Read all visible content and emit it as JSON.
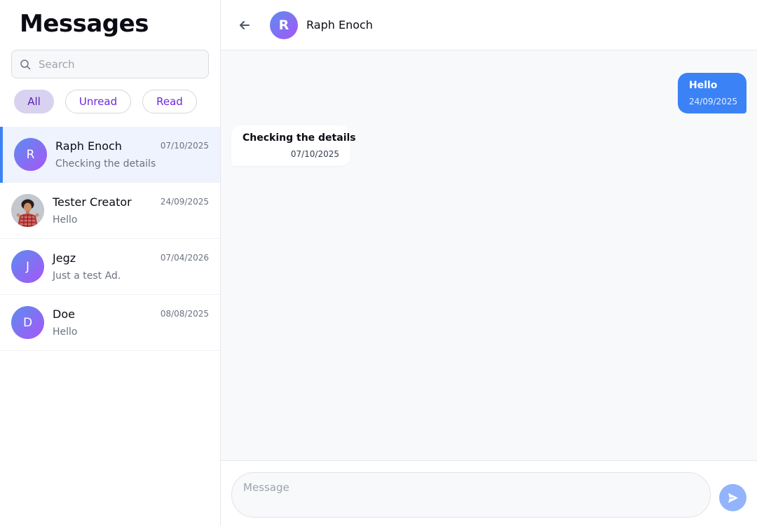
{
  "sidebar": {
    "title": "Messages",
    "search": {
      "placeholder": "Search",
      "value": ""
    },
    "filters": [
      {
        "label": "All",
        "active": true
      },
      {
        "label": "Unread",
        "active": false
      },
      {
        "label": "Read",
        "active": false
      }
    ],
    "conversations": [
      {
        "name": "Raph Enoch",
        "initial": "R",
        "date": "07/10/2025",
        "preview": "Checking the details",
        "active": true,
        "avatar": "initial"
      },
      {
        "name": "Tester Creator",
        "initial": "",
        "date": "24/09/2025",
        "preview": "Hello",
        "active": false,
        "avatar": "photo"
      },
      {
        "name": "Jegz",
        "initial": "J",
        "date": "07/04/2026",
        "preview": "Just a test Ad.",
        "active": false,
        "avatar": "initial"
      },
      {
        "name": "Doe",
        "initial": "D",
        "date": "08/08/2025",
        "preview": "Hello",
        "active": false,
        "avatar": "initial"
      }
    ]
  },
  "chat": {
    "header": {
      "initial": "R",
      "name": "Raph Enoch",
      "back_icon": "arrow-left-icon"
    },
    "messages": [
      {
        "direction": "outgoing",
        "text": "Hello",
        "time": "24/09/2025"
      },
      {
        "direction": "incoming",
        "text": "Checking the details",
        "time": "07/10/2025"
      }
    ],
    "composer": {
      "placeholder": "Message",
      "value": "",
      "send_icon": "send-icon"
    }
  },
  "colors": {
    "accent": "#3b82f6",
    "active_chip_bg": "#d8d2f0",
    "chip_text": "#6d28d9",
    "avatar_gradient_start": "#5b8def",
    "avatar_gradient_end": "#a855f7",
    "send_button": "#93b4fb",
    "active_row_bg": "#eef3fe"
  }
}
